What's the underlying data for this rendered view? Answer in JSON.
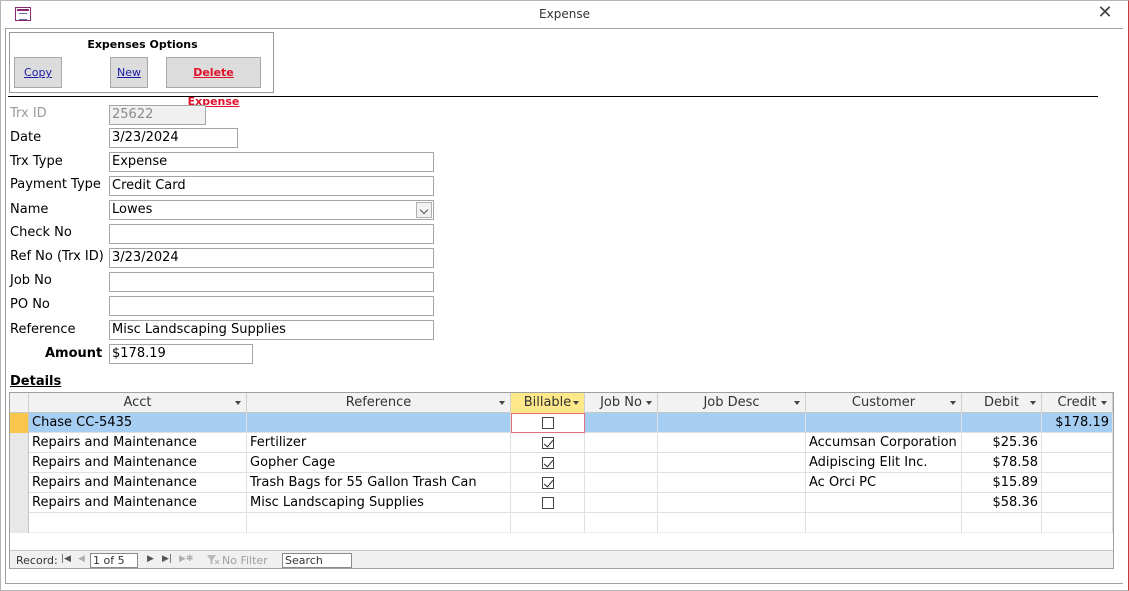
{
  "window": {
    "title": "Expense",
    "close_glyph": "✕"
  },
  "options": {
    "title": "Expenses Options",
    "copy_label": "Copy",
    "new_label": "New",
    "delete_label": "Delete Expense"
  },
  "fields": {
    "trx_id": {
      "label": "Trx ID",
      "value": "25622"
    },
    "date": {
      "label": "Date",
      "value": "3/23/2024"
    },
    "trx_type": {
      "label": "Trx Type",
      "value": "Expense"
    },
    "payment_type": {
      "label": "Payment Type",
      "value": "Credit Card"
    },
    "name": {
      "label": "Name",
      "value": "Lowes"
    },
    "check_no": {
      "label": "Check No",
      "value": ""
    },
    "ref_no": {
      "label": "Ref No (Trx ID)",
      "value": "3/23/2024"
    },
    "job_no": {
      "label": "Job No",
      "value": ""
    },
    "po_no": {
      "label": "PO No",
      "value": ""
    },
    "reference": {
      "label": "Reference",
      "value": "Misc Landscaping Supplies"
    },
    "amount": {
      "label": "Amount",
      "value": "$178.19"
    }
  },
  "details": {
    "label": "Details",
    "columns": [
      "Acct",
      "Reference",
      "Billable",
      "Job No",
      "Job Desc",
      "Customer",
      "Debit",
      "Credit"
    ],
    "rows": [
      {
        "acct": "Chase CC-5435",
        "reference": "",
        "billable": false,
        "job_no": "",
        "job_desc": "",
        "customer": "",
        "debit": "",
        "credit": "$178.19"
      },
      {
        "acct": "Repairs and Maintenance",
        "reference": "Fertilizer",
        "billable": true,
        "job_no": "",
        "job_desc": "",
        "customer": "Accumsan Corporation",
        "debit": "$25.36",
        "credit": ""
      },
      {
        "acct": "Repairs and Maintenance",
        "reference": "Gopher Cage",
        "billable": true,
        "job_no": "",
        "job_desc": "",
        "customer": "Adipiscing Elit Inc.",
        "debit": "$78.58",
        "credit": ""
      },
      {
        "acct": "Repairs and Maintenance",
        "reference": "Trash Bags for 55 Gallon Trash Can",
        "billable": true,
        "job_no": "",
        "job_desc": "",
        "customer": "Ac Orci PC",
        "debit": "$15.89",
        "credit": ""
      },
      {
        "acct": "Repairs and Maintenance",
        "reference": "Misc Landscaping Supplies",
        "billable": false,
        "job_no": "",
        "job_desc": "",
        "customer": "",
        "debit": "$58.36",
        "credit": ""
      }
    ]
  },
  "navigation": {
    "record_label": "Record:",
    "record_position": "1 of 5",
    "filter_label": "No Filter",
    "search_label": "Search",
    "icons": {
      "first": "first-record-icon",
      "prev": "prev-record-icon",
      "next": "next-record-icon",
      "last": "last-record-icon",
      "new": "new-record-icon"
    }
  },
  "colors": {
    "selected_row": "#a6cdf2",
    "active_header": "#fde88a",
    "delete_text": "#e0102a",
    "link_text": "#1a1aa6"
  }
}
